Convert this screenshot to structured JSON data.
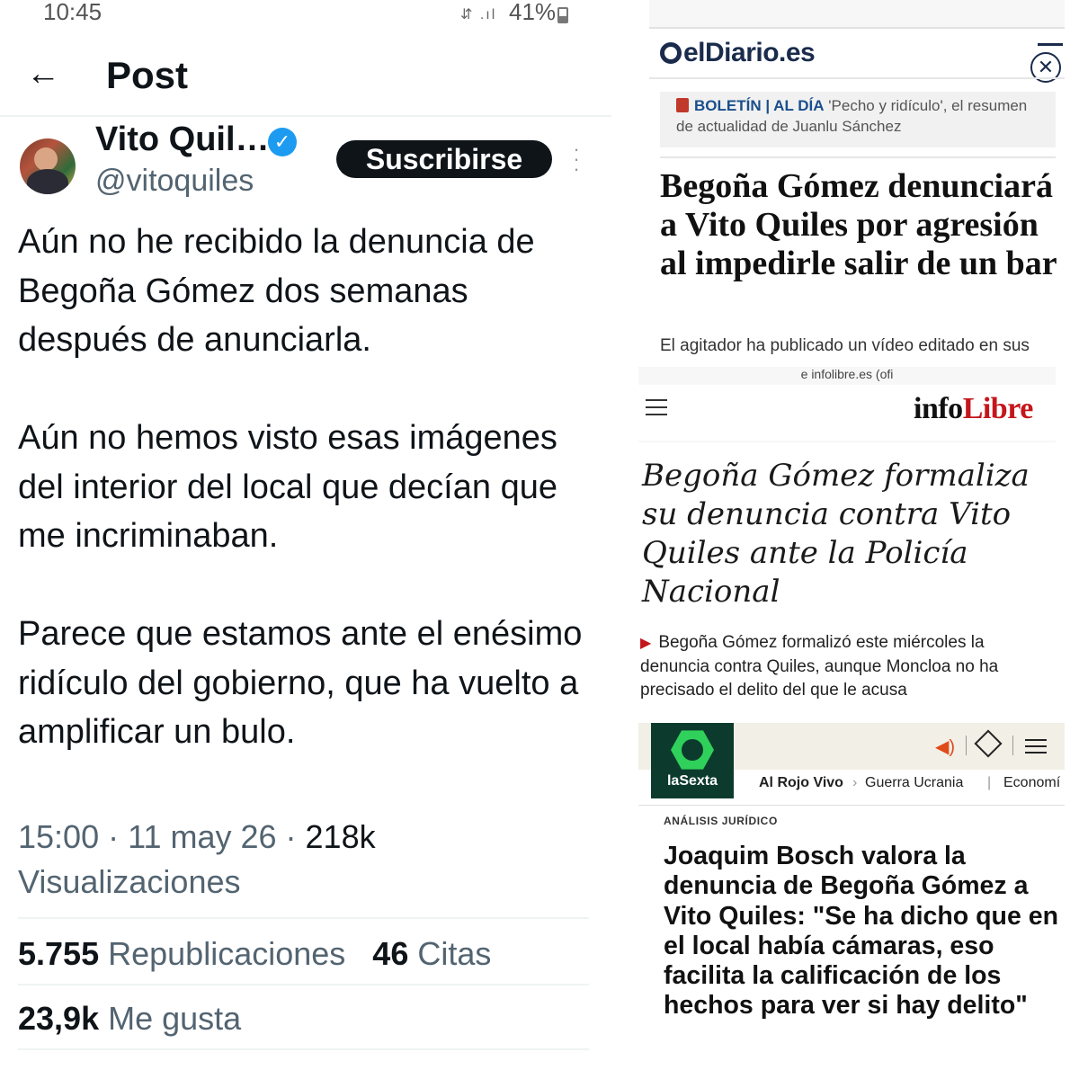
{
  "status_bar": {
    "time": "10:45",
    "battery": "41%"
  },
  "x_post": {
    "page_title": "Post",
    "author_name": "Vito Quil…",
    "author_handle": "@vitoquiles",
    "subscribe_label": "Suscribirse",
    "paragraphs": [
      "Aún no he recibido la denuncia de Begoña Gómez dos semanas después de anunciarla.",
      "Aún no hemos visto esas imágenes del interior del local que decían que me incriminaban.",
      "Parece que estamos ante el enésimo ridículo del gobierno, que ha vuelto a amplificar un bulo."
    ],
    "time": "15:00",
    "date": "11 may 26",
    "views_count": "218k",
    "views_label": "Visualizaciones",
    "reposts_count": "5.755",
    "reposts_label": "Republicaciones",
    "quotes_count": "46",
    "quotes_label": "Citas",
    "likes_count": "23,9k",
    "likes_label": "Me gusta"
  },
  "eldiario": {
    "logo": "elDiario.es",
    "bulletin_tag": "BOLETÍN | AL DÍA",
    "bulletin_text": "'Pecho y ridículo', el resumen de actualidad de Juanlu Sánchez",
    "headline": "Begoña Gómez denunciará a Vito Quiles por agresión al impedirle salir de un bar",
    "subheadline": "El agitador ha publicado un vídeo editado en sus"
  },
  "infolibre": {
    "url_fragment": "e infolibre.es (ofi",
    "logo_info": "info",
    "logo_libre": "Libre",
    "headline": "Begoña Gómez formaliza su denuncia contra Vito Quiles ante la Policía Nacional",
    "summary": "Begoña Gómez formalizó este miércoles la denuncia contra Quiles, aunque Moncloa no ha precisado el delito del que le acusa"
  },
  "lasexta": {
    "logo_label": "laSexta",
    "nav": [
      "Al Rojo Vivo",
      "Guerra Ucrania",
      "Economí"
    ],
    "kicker": "ANÁLISIS JURÍDICO",
    "headline": "Joaquim Bosch valora la denuncia de Begoña Gómez a Vito Quiles: \"Se ha dicho que en el local había cámaras, eso facilita la calificación de los hechos para ver si hay delito\""
  },
  "colors": {
    "x_text": "#0f1419",
    "x_secondary": "#536471",
    "x_verified": "#1d9bf0",
    "eldiario_brand": "#1a2b4c",
    "infolibre_red": "#c4161c",
    "lasexta_green": "#2fd15a",
    "lasexta_dark": "#0c3b2e"
  },
  "icons": [
    "back-arrow-icon",
    "verified-badge-icon",
    "more-options-icon",
    "close-icon",
    "download-icon",
    "hamburger-menu-icon",
    "speaker-icon",
    "share-icon",
    "menu-icon"
  ]
}
